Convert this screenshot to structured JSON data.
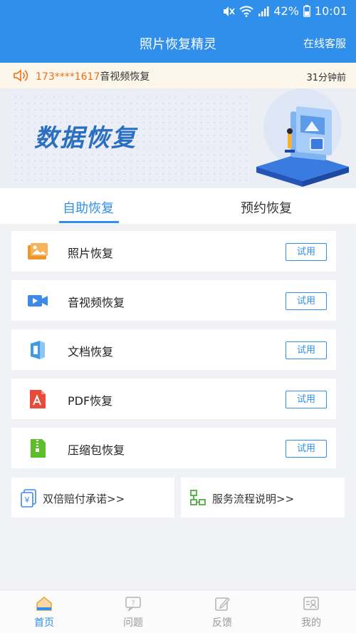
{
  "status_bar": {
    "battery": "42%",
    "time": "10:01"
  },
  "header": {
    "title": "照片恢复精灵",
    "service": "在线客服"
  },
  "notice": {
    "phone": "173****1617",
    "action": "音视频恢复",
    "time": "31分钟前"
  },
  "banner": {
    "title": "数据恢复"
  },
  "tabs": [
    {
      "label": "自助恢复",
      "active": true
    },
    {
      "label": "预约恢复",
      "active": false
    }
  ],
  "items": [
    {
      "label": "照片恢复",
      "button": "试用",
      "icon": "photo-icon",
      "color": "#f0952a"
    },
    {
      "label": "音视频恢复",
      "button": "试用",
      "icon": "video-icon",
      "color": "#3d8ae8"
    },
    {
      "label": "文档恢复",
      "button": "试用",
      "icon": "document-icon",
      "color": "#3d9be8"
    },
    {
      "label": "PDF恢复",
      "button": "试用",
      "icon": "pdf-icon",
      "color": "#e64b3c"
    },
    {
      "label": "压缩包恢复",
      "button": "试用",
      "icon": "zip-icon",
      "color": "#5cbf2a"
    }
  ],
  "cards": {
    "guarantee": "双倍赔付承诺>>",
    "process": "服务流程说明>>"
  },
  "nav": [
    {
      "label": "首页",
      "icon": "home-icon",
      "active": true
    },
    {
      "label": "问题",
      "icon": "question-icon",
      "active": false
    },
    {
      "label": "反馈",
      "icon": "feedback-icon",
      "active": false
    },
    {
      "label": "我的",
      "icon": "profile-icon",
      "active": false
    }
  ],
  "colors": {
    "primary": "#2f8fea",
    "notice_bg": "#fdf6ea",
    "phone": "#e8711a"
  }
}
